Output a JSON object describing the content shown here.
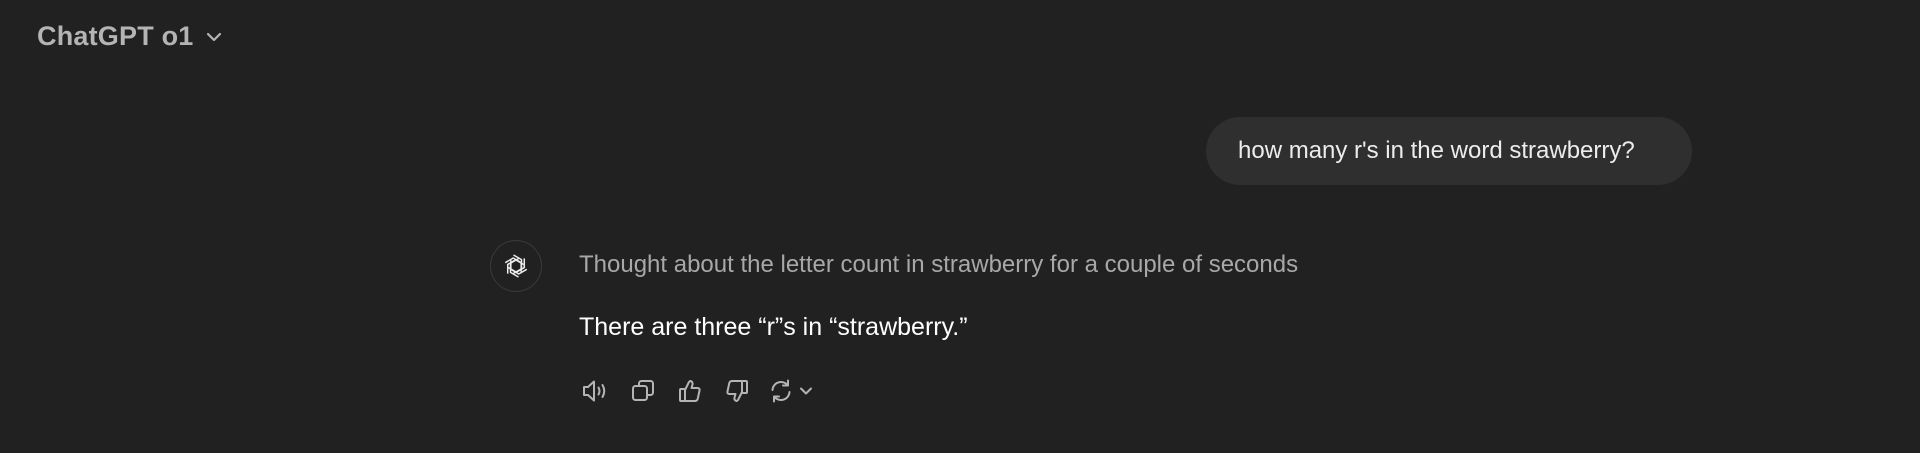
{
  "header": {
    "model_label": "ChatGPT o1",
    "chevron_icon": "chevron-down-icon"
  },
  "conversation": {
    "user_message": "how many r's in the word strawberry?",
    "assistant": {
      "avatar_icon": "openai-logo-icon",
      "thought_summary": "Thought about the letter count in strawberry for a couple of seconds",
      "answer": "There are three “r”s in “strawberry.”"
    },
    "actions": [
      {
        "name": "read-aloud",
        "icon": "speaker-icon"
      },
      {
        "name": "copy",
        "icon": "copy-icon"
      },
      {
        "name": "good-response",
        "icon": "thumbs-up-icon"
      },
      {
        "name": "bad-response",
        "icon": "thumbs-down-icon"
      },
      {
        "name": "regenerate",
        "icon": "refresh-icon"
      }
    ]
  },
  "colors": {
    "background": "#212121",
    "user_bubble": "#2f2f2f",
    "primary_text": "#ececec",
    "muted_text": "#a8a8a8"
  }
}
